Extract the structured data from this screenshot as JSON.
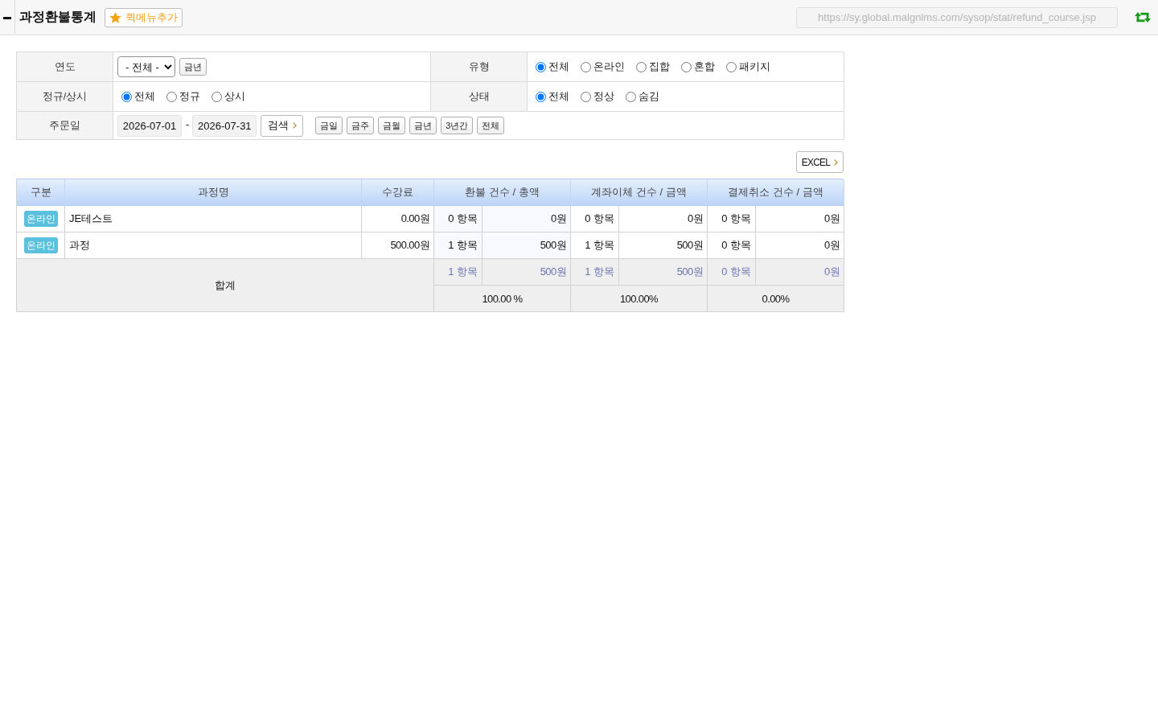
{
  "header": {
    "title": "과정환불통계",
    "quick_menu_button": "퀵메뉴추가",
    "url": "https://sy.global.malgnlms.com/sysop/stat/refund_course.jsp"
  },
  "filters": [
    {
      "label": "연도",
      "kind": "select",
      "value": "- 전체 -",
      "buttons": [
        "금년"
      ]
    },
    {
      "label": "유형",
      "kind": "radio",
      "options": [
        {
          "label": "전체",
          "selected": true
        },
        {
          "label": "온라인",
          "selected": false
        },
        {
          "label": "집합",
          "selected": false
        },
        {
          "label": "혼합",
          "selected": false
        },
        {
          "label": "패키지",
          "selected": false
        }
      ]
    },
    {
      "label": "정규/상시",
      "kind": "radio",
      "options": [
        {
          "label": "전체",
          "selected": true
        },
        {
          "label": "정규",
          "selected": false
        },
        {
          "label": "상시",
          "selected": false
        }
      ]
    },
    {
      "label": "상태",
      "kind": "radio",
      "options": [
        {
          "label": "전체",
          "selected": true
        },
        {
          "label": "정상",
          "selected": false
        },
        {
          "label": "숨김",
          "selected": false
        }
      ]
    },
    {
      "label": "주문일",
      "kind": "date_range",
      "start": "2026-07-01",
      "separator": "-",
      "end": "2026-07-31",
      "search_button": "검색",
      "buttons": [
        "금일",
        "금주",
        "금월",
        "금년",
        "3년간",
        "전체"
      ]
    }
  ],
  "excel_button": "EXCEL",
  "table": {
    "columns": [
      "구분",
      "과정명",
      "수강료",
      "환불 건수 / 총액",
      "계좌이체 건수 / 금액",
      "결제취소 건수 / 금액"
    ],
    "rows": [
      {
        "category": "온라인",
        "course": "JE테스트",
        "fee": "0.00원",
        "groups": [
          {
            "count": "0 항목",
            "amount": "0원"
          },
          {
            "count": "0 항목",
            "amount": "0원"
          },
          {
            "count": "0 항목",
            "amount": "0원"
          }
        ]
      },
      {
        "category": "온라인",
        "course": "과정",
        "fee": "500.00원",
        "groups": [
          {
            "count": "1 항목",
            "amount": "500원"
          },
          {
            "count": "1 항목",
            "amount": "500원"
          },
          {
            "count": "0 항목",
            "amount": "0원"
          }
        ]
      }
    ],
    "totals": {
      "label": "합계",
      "groups": [
        {
          "count": "1 항목",
          "amount": "500원",
          "share": "100.00 %"
        },
        {
          "count": "1 항목",
          "amount": "500원",
          "share": "100.00%"
        },
        {
          "count": "0 항목",
          "amount": "0원",
          "share": "0.00%"
        }
      ]
    }
  }
}
